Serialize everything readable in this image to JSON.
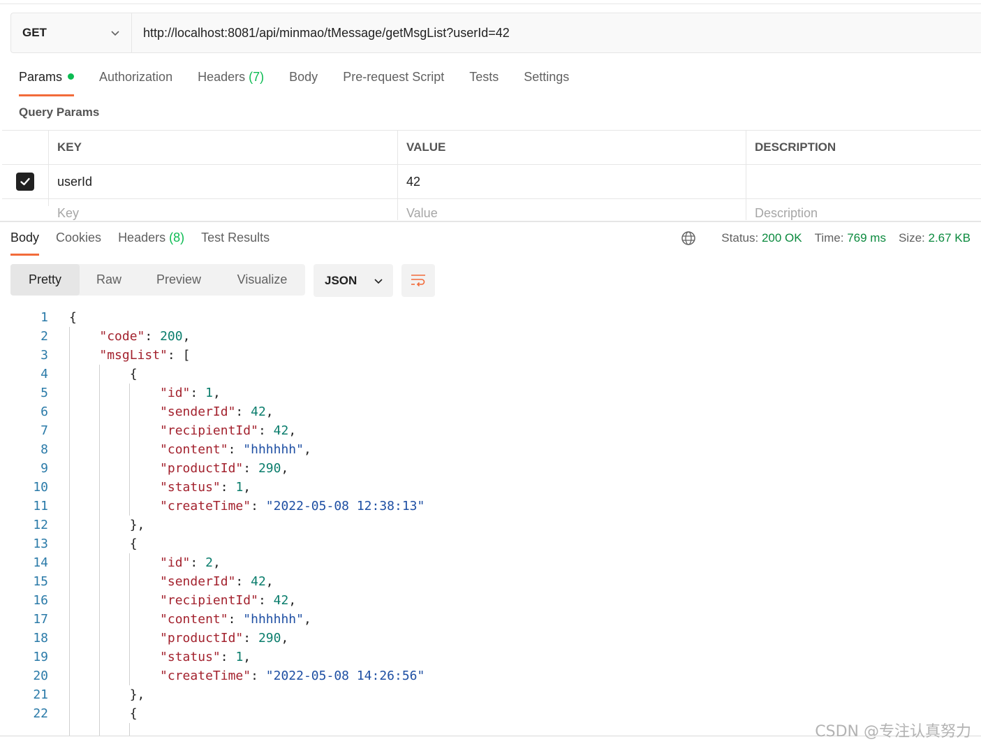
{
  "request": {
    "method": "GET",
    "url": "http://localhost:8081/api/minmao/tMessage/getMsgList?userId=42"
  },
  "request_tabs": [
    {
      "label": "Params",
      "active": true,
      "dot": true
    },
    {
      "label": "Authorization"
    },
    {
      "label": "Headers",
      "count": "(7)"
    },
    {
      "label": "Body"
    },
    {
      "label": "Pre-request Script"
    },
    {
      "label": "Tests"
    },
    {
      "label": "Settings"
    }
  ],
  "query_params": {
    "title": "Query Params",
    "columns": [
      "KEY",
      "VALUE",
      "DESCRIPTION"
    ],
    "rows": [
      {
        "checked": true,
        "key": "userId",
        "value": "42",
        "description": ""
      }
    ],
    "placeholders": {
      "key": "Key",
      "value": "Value",
      "description": "Description"
    }
  },
  "response_tabs": [
    {
      "label": "Body",
      "active": true
    },
    {
      "label": "Cookies"
    },
    {
      "label": "Headers",
      "count": "(8)"
    },
    {
      "label": "Test Results"
    }
  ],
  "response_status": {
    "status_label": "Status:",
    "status_value": "200 OK",
    "time_label": "Time:",
    "time_value": "769 ms",
    "size_label": "Size:",
    "size_value": "2.67 KB"
  },
  "format_buttons": [
    {
      "label": "Pretty",
      "active": true
    },
    {
      "label": "Raw"
    },
    {
      "label": "Preview"
    },
    {
      "label": "Visualize"
    }
  ],
  "format_select": "JSON",
  "code_lines": [
    [
      {
        "t": "{",
        "c": "p"
      }
    ],
    [
      {
        "t": "    ",
        "c": "p"
      },
      {
        "t": "\"code\"",
        "c": "k"
      },
      {
        "t": ": ",
        "c": "p"
      },
      {
        "t": "200",
        "c": "n"
      },
      {
        "t": ",",
        "c": "p"
      }
    ],
    [
      {
        "t": "    ",
        "c": "p"
      },
      {
        "t": "\"msgList\"",
        "c": "k"
      },
      {
        "t": ": [",
        "c": "p"
      }
    ],
    [
      {
        "t": "        {",
        "c": "p"
      }
    ],
    [
      {
        "t": "            ",
        "c": "p"
      },
      {
        "t": "\"id\"",
        "c": "k"
      },
      {
        "t": ": ",
        "c": "p"
      },
      {
        "t": "1",
        "c": "n"
      },
      {
        "t": ",",
        "c": "p"
      }
    ],
    [
      {
        "t": "            ",
        "c": "p"
      },
      {
        "t": "\"senderId\"",
        "c": "k"
      },
      {
        "t": ": ",
        "c": "p"
      },
      {
        "t": "42",
        "c": "n"
      },
      {
        "t": ",",
        "c": "p"
      }
    ],
    [
      {
        "t": "            ",
        "c": "p"
      },
      {
        "t": "\"recipientId\"",
        "c": "k"
      },
      {
        "t": ": ",
        "c": "p"
      },
      {
        "t": "42",
        "c": "n"
      },
      {
        "t": ",",
        "c": "p"
      }
    ],
    [
      {
        "t": "            ",
        "c": "p"
      },
      {
        "t": "\"content\"",
        "c": "k"
      },
      {
        "t": ": ",
        "c": "p"
      },
      {
        "t": "\"hhhhhh\"",
        "c": "s"
      },
      {
        "t": ",",
        "c": "p"
      }
    ],
    [
      {
        "t": "            ",
        "c": "p"
      },
      {
        "t": "\"productId\"",
        "c": "k"
      },
      {
        "t": ": ",
        "c": "p"
      },
      {
        "t": "290",
        "c": "n"
      },
      {
        "t": ",",
        "c": "p"
      }
    ],
    [
      {
        "t": "            ",
        "c": "p"
      },
      {
        "t": "\"status\"",
        "c": "k"
      },
      {
        "t": ": ",
        "c": "p"
      },
      {
        "t": "1",
        "c": "n"
      },
      {
        "t": ",",
        "c": "p"
      }
    ],
    [
      {
        "t": "            ",
        "c": "p"
      },
      {
        "t": "\"createTime\"",
        "c": "k"
      },
      {
        "t": ": ",
        "c": "p"
      },
      {
        "t": "\"2022-05-08 12:38:13\"",
        "c": "s"
      }
    ],
    [
      {
        "t": "        },",
        "c": "p"
      }
    ],
    [
      {
        "t": "        {",
        "c": "p"
      }
    ],
    [
      {
        "t": "            ",
        "c": "p"
      },
      {
        "t": "\"id\"",
        "c": "k"
      },
      {
        "t": ": ",
        "c": "p"
      },
      {
        "t": "2",
        "c": "n"
      },
      {
        "t": ",",
        "c": "p"
      }
    ],
    [
      {
        "t": "            ",
        "c": "p"
      },
      {
        "t": "\"senderId\"",
        "c": "k"
      },
      {
        "t": ": ",
        "c": "p"
      },
      {
        "t": "42",
        "c": "n"
      },
      {
        "t": ",",
        "c": "p"
      }
    ],
    [
      {
        "t": "            ",
        "c": "p"
      },
      {
        "t": "\"recipientId\"",
        "c": "k"
      },
      {
        "t": ": ",
        "c": "p"
      },
      {
        "t": "42",
        "c": "n"
      },
      {
        "t": ",",
        "c": "p"
      }
    ],
    [
      {
        "t": "            ",
        "c": "p"
      },
      {
        "t": "\"content\"",
        "c": "k"
      },
      {
        "t": ": ",
        "c": "p"
      },
      {
        "t": "\"hhhhhh\"",
        "c": "s"
      },
      {
        "t": ",",
        "c": "p"
      }
    ],
    [
      {
        "t": "            ",
        "c": "p"
      },
      {
        "t": "\"productId\"",
        "c": "k"
      },
      {
        "t": ": ",
        "c": "p"
      },
      {
        "t": "290",
        "c": "n"
      },
      {
        "t": ",",
        "c": "p"
      }
    ],
    [
      {
        "t": "            ",
        "c": "p"
      },
      {
        "t": "\"status\"",
        "c": "k"
      },
      {
        "t": ": ",
        "c": "p"
      },
      {
        "t": "1",
        "c": "n"
      },
      {
        "t": ",",
        "c": "p"
      }
    ],
    [
      {
        "t": "            ",
        "c": "p"
      },
      {
        "t": "\"createTime\"",
        "c": "k"
      },
      {
        "t": ": ",
        "c": "p"
      },
      {
        "t": "\"2022-05-08 14:26:56\"",
        "c": "s"
      }
    ],
    [
      {
        "t": "        },",
        "c": "p"
      }
    ],
    [
      {
        "t": "        {",
        "c": "p"
      }
    ]
  ],
  "watermark": "CSDN @专注认真努力",
  "colors": {
    "accent": "#f26b3a",
    "success": "#0cbb52",
    "key": "#a3222e",
    "number": "#0a7d6c",
    "string": "#1e4fa3"
  },
  "icons": {
    "method_dropdown": "chevron-down-icon",
    "checkbox": "check-icon",
    "status": "globe-icon",
    "format_dropdown": "chevron-down-icon",
    "wrap": "wrap-lines-icon"
  }
}
